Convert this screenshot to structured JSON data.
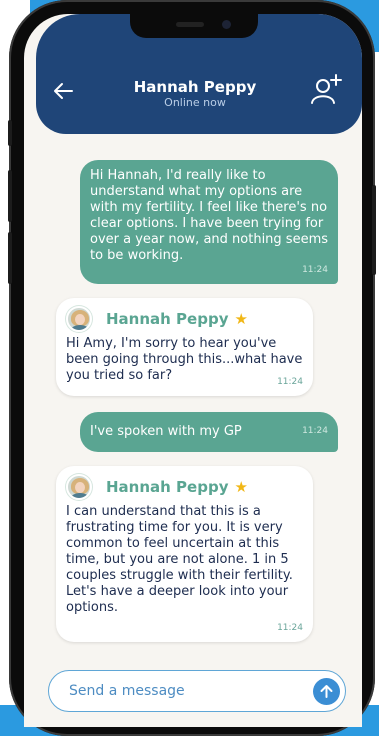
{
  "header": {
    "contact_name": "Hannah Peppy",
    "contact_status": "Online now"
  },
  "icons": {
    "back": "arrow-left-icon",
    "add_user": "add-user-icon",
    "star": "star-icon",
    "send": "arrow-up-icon"
  },
  "messages": [
    {
      "type": "sent",
      "text": "Hi Hannah, I'd really like to understand what my options are with my fertility. I feel like there's no clear options. I have been trying for over a year now, and nothing seems to be working.",
      "time": "11:24"
    },
    {
      "type": "received",
      "sender": "Hannah Peppy",
      "text": "Hi Amy, I'm sorry to hear you've been going through this...what have you tried so far?",
      "time": "11:24"
    },
    {
      "type": "sent",
      "text": "I've spoken with my GP",
      "time": "11:24"
    },
    {
      "type": "received",
      "sender": "Hannah Peppy",
      "text": "I can understand that this is a frustrating time for you. It is very common to feel uncertain at this time, but you are not alone. 1 in 5 couples struggle with their fertility. Let's have a deeper look into your options.",
      "time": "11:24"
    }
  ],
  "composer": {
    "placeholder": "Send a message"
  },
  "colors": {
    "header": "#1f4578",
    "sent_bubble": "#5aa592",
    "received_name": "#5aa592",
    "accent_blue": "#3b8ed4",
    "star": "#f1b716"
  }
}
